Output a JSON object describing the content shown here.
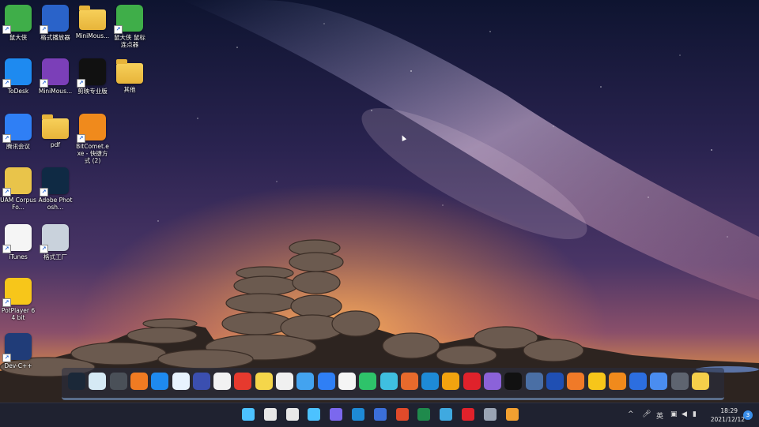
{
  "desktop": {
    "icons": [
      {
        "label": "鼠大侠",
        "icon": "mouse-helper-icon",
        "color": "#3fae49"
      },
      {
        "label": "格式播放器",
        "icon": "format-player-icon",
        "color": "#2a63c9"
      },
      {
        "label": "MiniMous...",
        "icon": "folder-icon",
        "color": "#e7b43a"
      },
      {
        "label": "鼠大侠 鼠标连点器",
        "icon": "mouse-helper-clicker-icon",
        "color": "#3fae49"
      },
      {
        "label": "ToDesk",
        "icon": "todesk-icon",
        "color": "#1e8af0"
      },
      {
        "label": "MiniMous...",
        "icon": "rar-archive-icon",
        "color": "#7b3fb8"
      },
      {
        "label": "剪映专业版",
        "icon": "capcut-icon",
        "color": "#111111"
      },
      {
        "label": "其他",
        "icon": "folder-icon",
        "color": "#e7b43a"
      },
      {
        "label": "腾讯会议",
        "icon": "tencent-meeting-icon",
        "color": "#2f7ff5"
      },
      {
        "label": "pdf",
        "icon": "folder-icon",
        "color": "#e7b43a"
      },
      {
        "label": "BitComet.exe - 快捷方式 (2)",
        "icon": "bitcomet-icon",
        "color": "#f08a1c"
      },
      {
        "label": "UAM Corpus Fo...",
        "icon": "uam-corpus-icon",
        "color": "#e9c44a"
      },
      {
        "label": "Adobe Photosh...",
        "icon": "photoshop-icon",
        "color": "#0f2a44"
      },
      {
        "label": "iTunes",
        "icon": "itunes-icon",
        "color": "#f5f5f5"
      },
      {
        "label": "格式工厂",
        "icon": "format-factory-icon",
        "color": "#c9d2dc"
      },
      {
        "label": "PotPlayer 64 bit",
        "icon": "potplayer-icon",
        "color": "#f7c61a"
      },
      {
        "label": "Dev-C++",
        "icon": "devcpp-icon",
        "color": "#203c78"
      }
    ]
  },
  "dock": {
    "apps": [
      {
        "icon": "steam-icon",
        "color": "#1b2838"
      },
      {
        "icon": "app-icon",
        "color": "#d6eaf5"
      },
      {
        "icon": "app-icon",
        "color": "#4a5058"
      },
      {
        "icon": "v-app-icon",
        "color": "#f07b22"
      },
      {
        "icon": "todesk-icon",
        "color": "#1e8af0"
      },
      {
        "icon": "app-icon",
        "color": "#e8f3ff"
      },
      {
        "icon": "v-app-icon",
        "color": "#3b4fb0"
      },
      {
        "icon": "u-app-icon",
        "color": "#f2f2f2"
      },
      {
        "icon": "qq-icon",
        "color": "#e63a2e"
      },
      {
        "icon": "app-icon",
        "color": "#f5d64a"
      },
      {
        "icon": "wechat-icon",
        "color": "#f0f0f0"
      },
      {
        "icon": "app-icon",
        "color": "#43a3f0"
      },
      {
        "icon": "tencent-meeting-icon",
        "color": "#2f7ff5"
      },
      {
        "icon": "cloud-icon",
        "color": "#f5f5f5"
      },
      {
        "icon": "play-icon",
        "color": "#2ec36a"
      },
      {
        "icon": "app-icon",
        "color": "#3fbfe0"
      },
      {
        "icon": "matlab-icon",
        "color": "#e86a2c"
      },
      {
        "icon": "edge-icon",
        "color": "#1e8ad6"
      },
      {
        "icon": "app-icon",
        "color": "#f2a30f"
      },
      {
        "icon": "record-icon",
        "color": "#e0222b"
      },
      {
        "icon": "app-icon",
        "color": "#8b62d9"
      },
      {
        "icon": "capcut-icon",
        "color": "#111111"
      },
      {
        "icon": "app-icon",
        "color": "#4a6fa5"
      },
      {
        "icon": "app-icon",
        "color": "#1f4fb3"
      },
      {
        "icon": "app-icon",
        "color": "#f07a28"
      },
      {
        "icon": "potplayer-icon",
        "color": "#f7c61a"
      },
      {
        "icon": "bitcomet-icon",
        "color": "#f08a1c"
      },
      {
        "icon": "wps-icon",
        "color": "#2c6ee0"
      },
      {
        "icon": "star-app-icon",
        "color": "#4a8df0"
      },
      {
        "icon": "grid-app-icon",
        "color": "#5e6470"
      },
      {
        "icon": "sticky-note-icon",
        "color": "#f5cf4a"
      }
    ]
  },
  "taskbar": {
    "apps": [
      {
        "icon": "windows-start-icon",
        "color": "#4cc2ff"
      },
      {
        "icon": "search-icon",
        "color": "#e8e8e8"
      },
      {
        "icon": "task-view-icon",
        "color": "#e8e8e8"
      },
      {
        "icon": "widgets-icon",
        "color": "#4cc2ff"
      },
      {
        "icon": "chat-icon",
        "color": "#7b68ee"
      },
      {
        "icon": "edge-icon",
        "color": "#1e8ad6"
      },
      {
        "icon": "app-icon",
        "color": "#3b6fd9"
      },
      {
        "icon": "app-icon",
        "color": "#e04a2a"
      },
      {
        "icon": "excel-icon",
        "color": "#1f8a4c"
      },
      {
        "icon": "app-icon",
        "color": "#3fa9e0"
      },
      {
        "icon": "record-icon",
        "color": "#e0222b"
      },
      {
        "icon": "settings-icon",
        "color": "#9aa4b4"
      },
      {
        "icon": "app-icon",
        "color": "#f2a030"
      }
    ],
    "tray": {
      "chevron": "^",
      "ime": "英",
      "time": "18:29",
      "date": "2021/12/12",
      "notifications": "3"
    }
  }
}
